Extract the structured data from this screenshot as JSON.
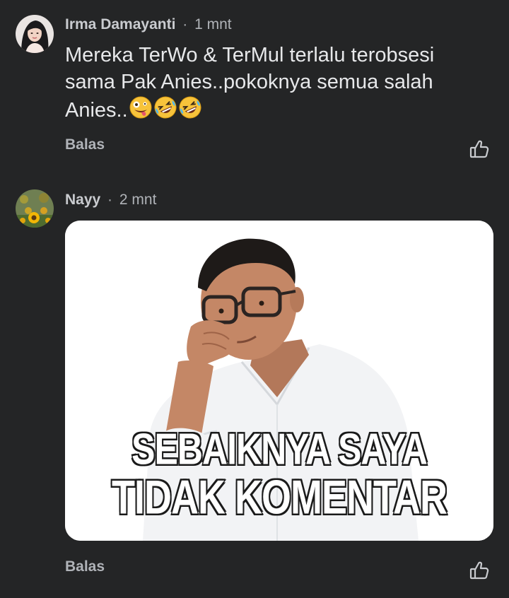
{
  "comments": [
    {
      "author": "Irma Damayanti",
      "separator": "·",
      "time": "1 mnt",
      "text": "Mereka TerWo & TerMul terlalu terobsesi sama Pak Anies..pokoknya semua salah Anies..",
      "emojis": [
        "zany-face-emoji",
        "rolling-on-floor-laughing-emoji",
        "rolling-on-floor-laughing-emoji"
      ],
      "reply_label": "Balas"
    },
    {
      "author": "Nayy",
      "separator": "·",
      "time": "2 mnt",
      "meme": {
        "caption_line1": "SEBAIKNYA SAYA",
        "caption_line2": "TIDAK KOMENTAR"
      },
      "reply_label": "Balas"
    }
  ],
  "colors": {
    "background": "#242526",
    "text_primary": "#e4e6eb",
    "text_secondary": "#b0b3b8"
  },
  "icons": [
    "thumbs-up-icon"
  ]
}
